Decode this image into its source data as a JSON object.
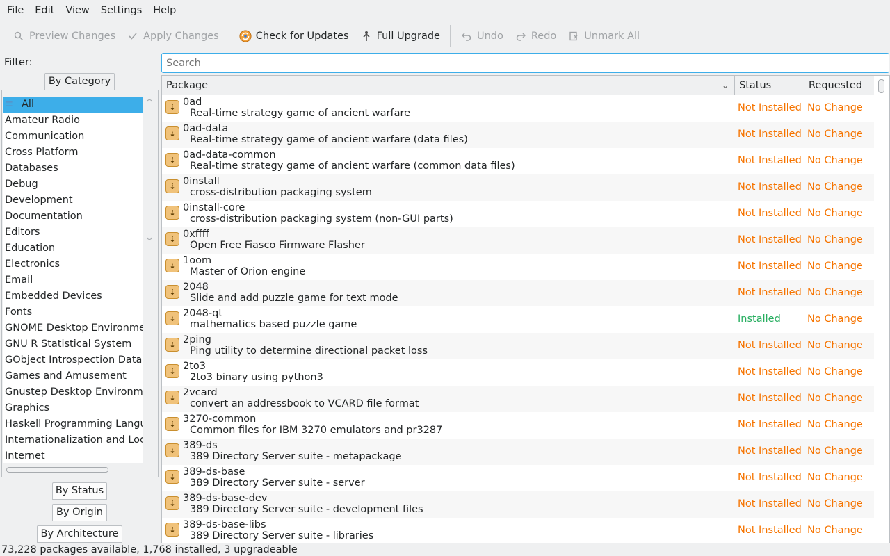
{
  "menu": [
    "File",
    "Edit",
    "View",
    "Settings",
    "Help"
  ],
  "toolbar": {
    "preview": "Preview Changes",
    "apply": "Apply Changes",
    "check": "Check for Updates",
    "upgrade": "Full Upgrade",
    "undo": "Undo",
    "redo": "Redo",
    "unmark": "Unmark All"
  },
  "filter": {
    "label": "Filter:",
    "tab_category": "By Category",
    "tab_status": "By Status",
    "tab_origin": "By Origin",
    "tab_arch": "By Architecture"
  },
  "search": {
    "placeholder": "Search"
  },
  "categories": [
    "All",
    "Amateur Radio",
    "Communication",
    "Cross Platform",
    "Databases",
    "Debug",
    "Development",
    "Documentation",
    "Editors",
    "Education",
    "Electronics",
    "Email",
    "Embedded Devices",
    "Fonts",
    "GNOME Desktop Environmen",
    "GNU R Statistical System",
    "GObject Introspection Data",
    "Games and Amusement",
    "Gnustep Desktop Environmen",
    "Graphics",
    "Haskell Programming Langua",
    "Internationalization and Loca",
    "Internet"
  ],
  "table": {
    "col_package": "Package",
    "col_status": "Status",
    "col_requested": "Requested",
    "rows": [
      {
        "name": "0ad",
        "desc": "Real-time strategy game of ancient warfare",
        "status": "Not Installed",
        "req": "No Change"
      },
      {
        "name": "0ad-data",
        "desc": "Real-time strategy game of ancient warfare (data files)",
        "status": "Not Installed",
        "req": "No Change"
      },
      {
        "name": "0ad-data-common",
        "desc": "Real-time strategy game of ancient warfare (common data files)",
        "status": "Not Installed",
        "req": "No Change"
      },
      {
        "name": "0install",
        "desc": "cross-distribution packaging system",
        "status": "Not Installed",
        "req": "No Change"
      },
      {
        "name": "0install-core",
        "desc": "cross-distribution packaging system (non-GUI parts)",
        "status": "Not Installed",
        "req": "No Change"
      },
      {
        "name": "0xffff",
        "desc": "Open Free Fiasco Firmware Flasher",
        "status": "Not Installed",
        "req": "No Change"
      },
      {
        "name": "1oom",
        "desc": "Master of Orion engine",
        "status": "Not Installed",
        "req": "No Change"
      },
      {
        "name": "2048",
        "desc": "Slide and add puzzle game for text mode",
        "status": "Not Installed",
        "req": "No Change"
      },
      {
        "name": "2048-qt",
        "desc": "mathematics based puzzle game",
        "status": "Installed",
        "req": "No Change"
      },
      {
        "name": "2ping",
        "desc": "Ping utility to determine directional packet loss",
        "status": "Not Installed",
        "req": "No Change"
      },
      {
        "name": "2to3",
        "desc": "2to3 binary using python3",
        "status": "Not Installed",
        "req": "No Change"
      },
      {
        "name": "2vcard",
        "desc": "convert an addressbook to VCARD file format",
        "status": "Not Installed",
        "req": "No Change"
      },
      {
        "name": "3270-common",
        "desc": "Common files for IBM 3270 emulators and pr3287",
        "status": "Not Installed",
        "req": "No Change"
      },
      {
        "name": "389-ds",
        "desc": "389 Directory Server suite - metapackage",
        "status": "Not Installed",
        "req": "No Change"
      },
      {
        "name": "389-ds-base",
        "desc": "389 Directory Server suite - server",
        "status": "Not Installed",
        "req": "No Change"
      },
      {
        "name": "389-ds-base-dev",
        "desc": "389 Directory Server suite - development files",
        "status": "Not Installed",
        "req": "No Change"
      },
      {
        "name": "389-ds-base-libs",
        "desc": "389 Directory Server suite - libraries",
        "status": "Not Installed",
        "req": "No Change"
      }
    ]
  },
  "statusbar": "73,228 packages available, 1,768 installed, 3 upgradeable"
}
